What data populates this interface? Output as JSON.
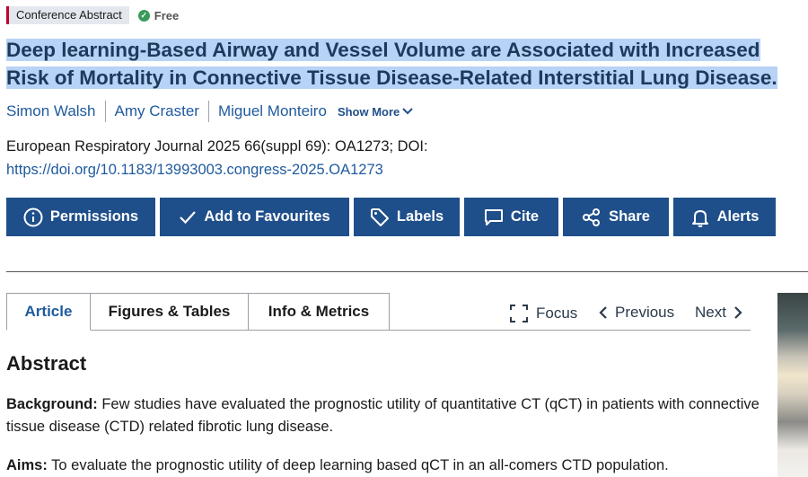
{
  "meta": {
    "badge": "Conference Abstract",
    "access": "Free"
  },
  "title": "Deep learning-Based Airway and Vessel Volume are Associated with Increased Risk of Mortality in Connective Tissue Disease-Related Interstitial Lung Disease.",
  "authors": [
    "Simon Walsh",
    "Amy Craster",
    "Miguel Monteiro"
  ],
  "show_more": "Show More",
  "citation": {
    "journal_line": "European Respiratory Journal 2025 66(suppl 69): OA1273; DOI:",
    "doi": "https://doi.org/10.1183/13993003.congress-2025.OA1273"
  },
  "actions": {
    "permissions": "Permissions",
    "favourites": "Add to Favourites",
    "labels": "Labels",
    "cite": "Cite",
    "share": "Share",
    "alerts": "Alerts"
  },
  "tabs": {
    "article": "Article",
    "figures": "Figures & Tables",
    "info": "Info & Metrics"
  },
  "nav": {
    "focus": "Focus",
    "previous": "Previous",
    "next": "Next"
  },
  "abstract": {
    "heading": "Abstract",
    "background_label": "Background:",
    "background_text": " Few studies have evaluated the prognostic utility of quantitative CT (qCT) in patients with connective tissue disease (CTD) related fibrotic lung disease.",
    "aims_label": "Aims:",
    "aims_text": " To evaluate the prognostic utility of deep learning based qCT in an all-comers CTD population."
  },
  "colors": {
    "brand_blue": "#1f4f8a",
    "link_blue": "#1f5a9e",
    "title_highlight": "#b7d3f5",
    "free_green": "#3a9a5a"
  }
}
